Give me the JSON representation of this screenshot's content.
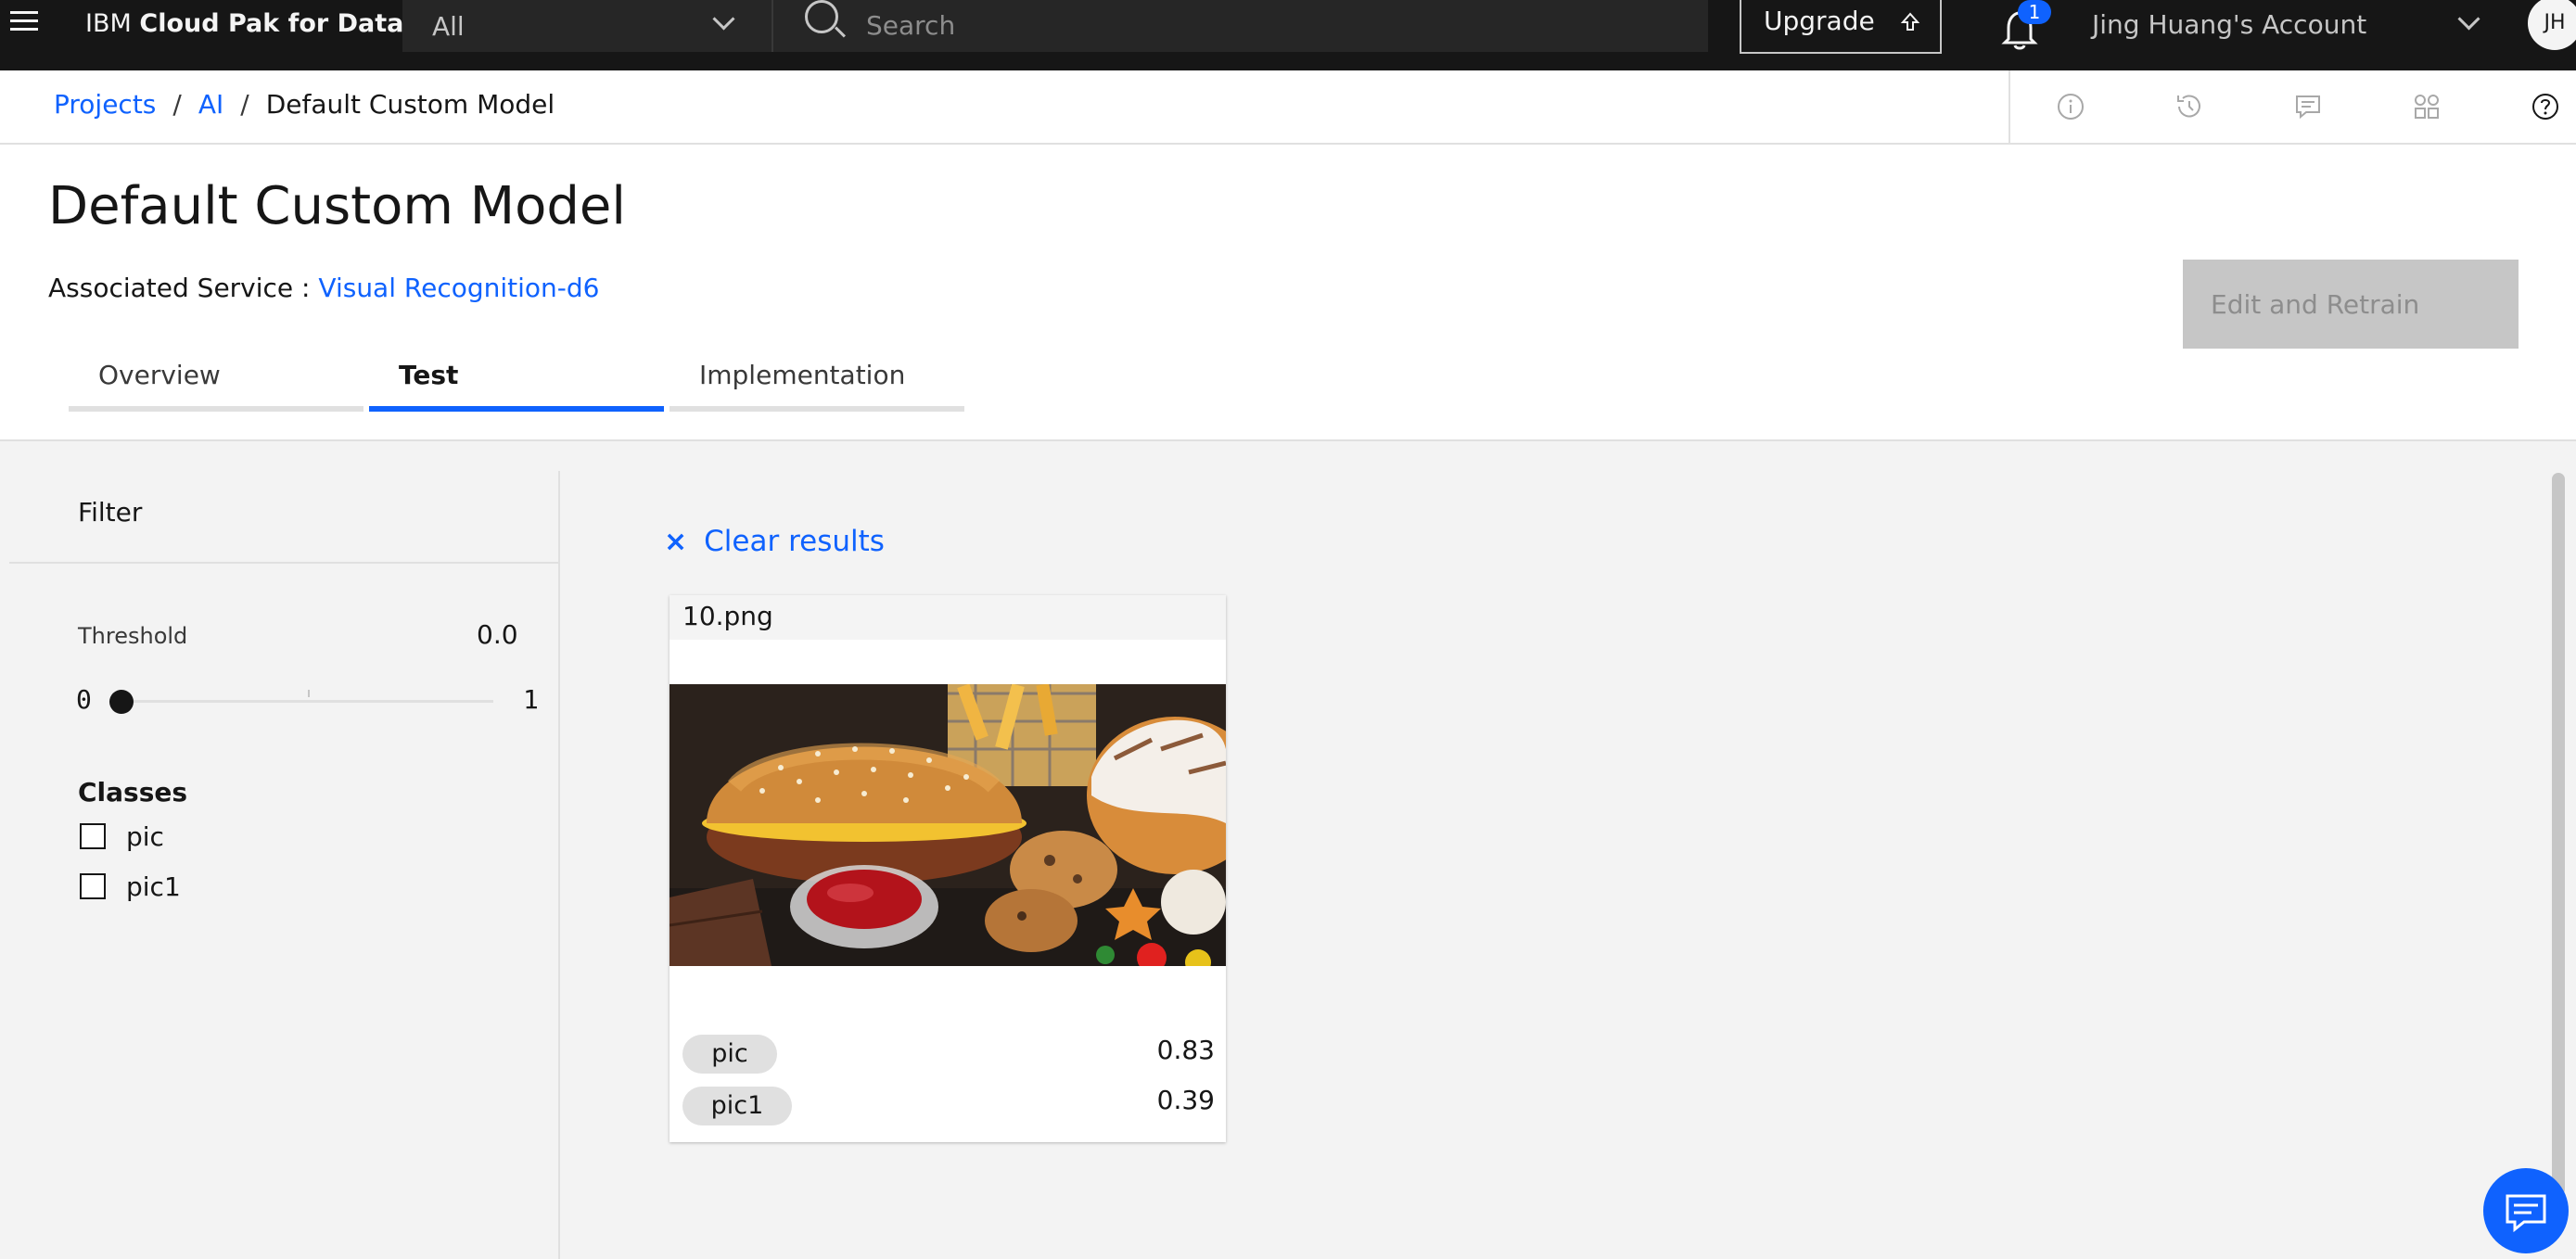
{
  "topbar": {
    "brand_prefix": "IBM ",
    "brand_name": "Cloud Pak for Data",
    "scope_value": "All",
    "search_placeholder": "Search",
    "upgrade_label": "Upgrade",
    "notification_count": "1",
    "account_name": "Jing Huang's Account",
    "avatar_initials": "JH"
  },
  "breadcrumb": {
    "items": [
      "Projects",
      "AI"
    ],
    "separator": "/",
    "current": "Default Custom Model"
  },
  "header": {
    "title": "Default Custom Model",
    "associated_label": "Associated Service :",
    "associated_link": "Visual Recognition-d6",
    "retrain_label": "Edit and Retrain",
    "tabs": [
      {
        "label": "Overview",
        "active": false
      },
      {
        "label": "Test",
        "active": true
      },
      {
        "label": "Implementation",
        "active": false
      }
    ]
  },
  "filter": {
    "title": "Filter",
    "threshold_label": "Threshold",
    "threshold_value": "0.0",
    "slider_min": "0",
    "slider_max": "1",
    "slider_level": 0,
    "classes_heading": "Classes",
    "classes": [
      {
        "label": "pic",
        "checked": false
      },
      {
        "label": "pic1",
        "checked": false
      }
    ]
  },
  "results": {
    "clear_icon": "×",
    "clear_label": "Clear results",
    "card": {
      "filename": "10.png",
      "scores": [
        {
          "class": "pic",
          "score": "0.83"
        },
        {
          "class": "pic1",
          "score": "0.39"
        }
      ]
    }
  },
  "colors": {
    "accent": "#0f62fe",
    "topbar": "#161616",
    "disabled_button": "#c6c6c6"
  },
  "icons": [
    "hamburger-icon",
    "chevron-down-icon",
    "search-icon",
    "upload-icon",
    "bell-icon",
    "info-icon",
    "history-icon",
    "comment-icon",
    "apps-icon",
    "help-icon",
    "close-icon",
    "chat-icon"
  ]
}
